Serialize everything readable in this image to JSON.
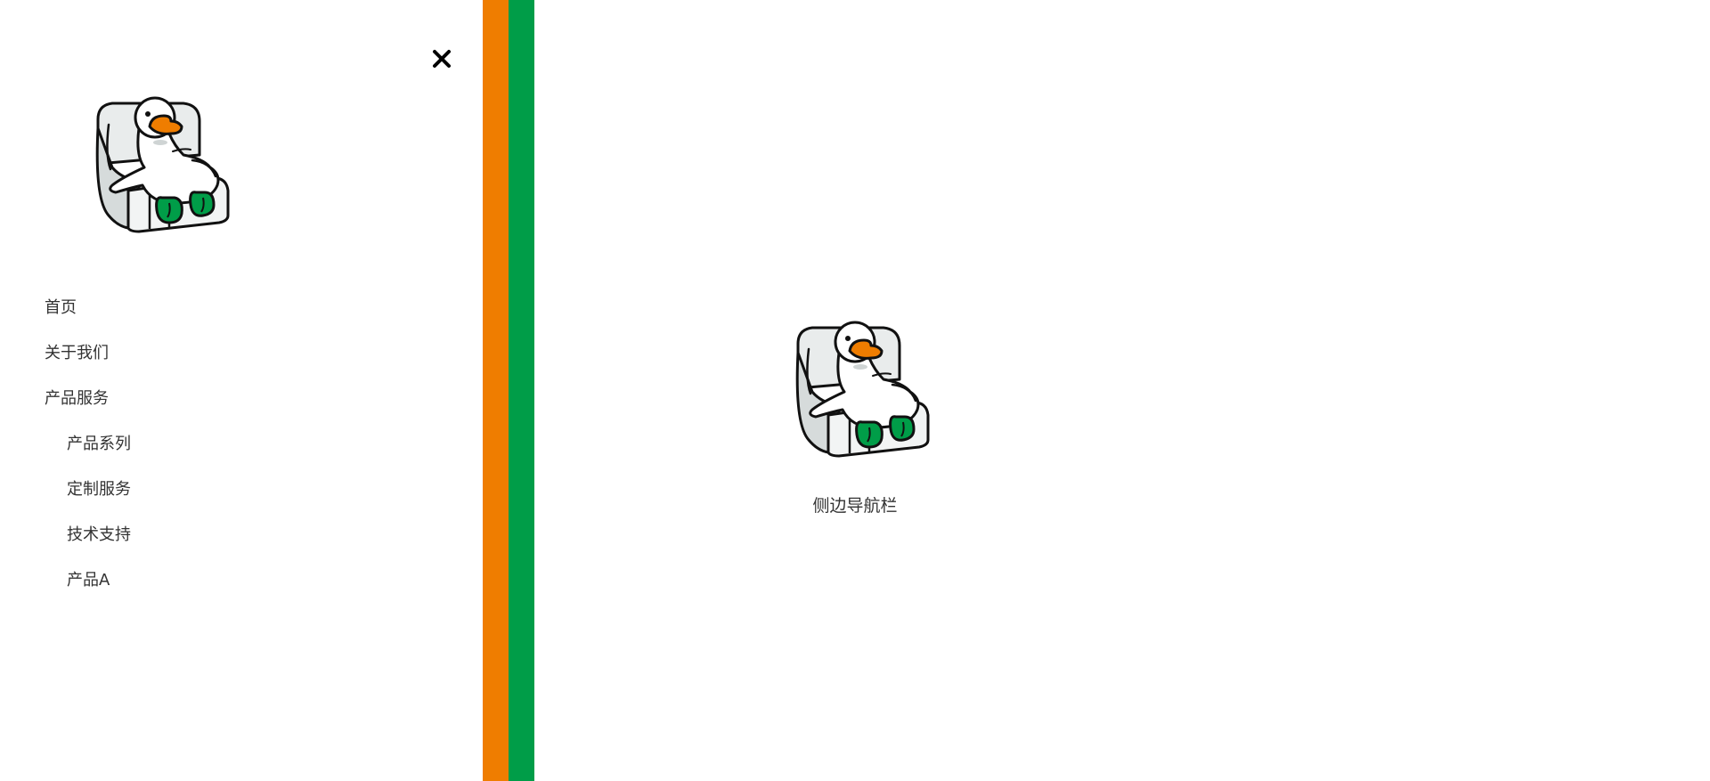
{
  "sidebar": {
    "close_icon": "close-icon",
    "logo_icon": "goose-in-armchair-logo",
    "menu": [
      {
        "label": "首页",
        "level": 1
      },
      {
        "label": "关于我们",
        "level": 1
      },
      {
        "label": "产品服务",
        "level": 1
      },
      {
        "label": "产品系列",
        "level": 2
      },
      {
        "label": "定制服务",
        "level": 2
      },
      {
        "label": "技术支持",
        "level": 2
      },
      {
        "label": "产品A",
        "level": 2
      }
    ]
  },
  "content": {
    "logo_icon": "goose-in-armchair-logo",
    "caption": "侧边导航栏"
  },
  "colors": {
    "accent_orange": "#ef7d00",
    "accent_green": "#009d48",
    "text": "#333333",
    "background": "#ffffff"
  }
}
